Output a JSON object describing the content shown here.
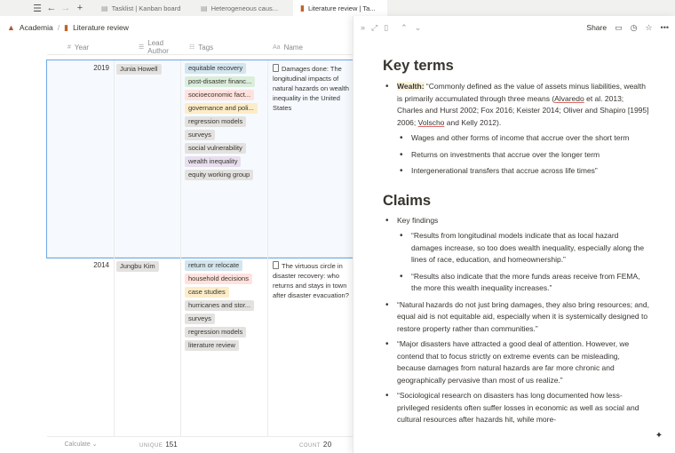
{
  "tabs": [
    {
      "label": "Tasklist | Kanban board",
      "active": false
    },
    {
      "label": "Heterogeneous caus...",
      "active": false
    },
    {
      "label": "Literature review | Ta...",
      "active": true
    }
  ],
  "breadcrumb": {
    "workspace": "Academia",
    "page": "Literature review"
  },
  "table": {
    "columns": {
      "year": "Year",
      "lead_author": "Lead Author",
      "tags": "Tags",
      "name": "Name"
    },
    "rows": [
      {
        "year": "2019",
        "lead_author": "Junia Howell",
        "tags": [
          "equitable recovery",
          "post-disaster financ...",
          "socioeconomic fact...",
          "governance and poli...",
          "regression models",
          "surveys",
          "social vulnerability",
          "wealth inequality",
          "equity working group"
        ],
        "name": "Damages done: The longitudinal impacts of natural hazards on wealth inequality in the United States"
      },
      {
        "year": "2014",
        "lead_author": "Jungbu Kim",
        "tags": [
          "return or relocate",
          "household decisions",
          "case studies",
          "hurricanes and stor...",
          "surveys",
          "regression models",
          "literature review"
        ],
        "name": "The virtuous circle in disaster recovery: who returns and stays in town after disaster evacuation?"
      }
    ],
    "footer": {
      "calculate": "Calculate",
      "unique_label": "UNIQUE",
      "unique_value": "151",
      "count_label": "COUNT",
      "count_value": "20"
    }
  },
  "peek": {
    "share_label": "Share",
    "key_terms_heading": "Key terms",
    "wealth_term": "Wealth:",
    "wealth_definition_a": "“Commonly defined as the value of assets minus liabilities, wealth is primarily accumulated through three means (",
    "wealth_cite_1": "Alvaredo",
    "wealth_definition_b": " et al. 2013; Charles and Hurst 2002; Fox 2016; Keister 2014; Oliver and Shapiro [1995] 2006; ",
    "wealth_cite_2": "Volscho",
    "wealth_definition_c": " and Kelly 2012).",
    "wealth_subitems": [
      "Wages and other forms of income that accrue over the short term",
      "Returns on investments that accrue over the longer term",
      "Intergenerational transfers that accrue across life times”"
    ],
    "claims_heading": "Claims",
    "key_findings_label": "Key findings",
    "key_findings": [
      "“Results from longitudinal models indicate that as local hazard damages increase, so too does wealth inequality, especially along the lines of race, education, and homeownership.”",
      "“Results also indicate that the more funds areas receive from FEMA, the more this wealth inequality increases.”"
    ],
    "claims": [
      "“Natural hazards do not just bring damages, they also bring resources; and, equal aid is not equitable aid, especially when it is systemically designed to restore property rather than communities.”",
      "“Major disasters have attracted a good deal of attention. However, we contend that to focus strictly on extreme events can be misleading, because damages from natural hazards are far more chronic and geographically pervasive than most of us realize.”",
      "“Sociological research on disasters has long documented how less-privileged residents often suffer losses in economic as well as social and cultural resources after hazards hit, while more-"
    ]
  },
  "colors": {
    "accent": "#2383e2",
    "tag_blue": "#d3e5ef",
    "tag_green": "#dbeddb",
    "tag_red": "#ffe2dd",
    "tag_yellow": "#fdecc8",
    "tag_gray": "#e3e2e0",
    "tag_purple": "#e8deee",
    "tag_orange": "#fadec9",
    "tag_pink": "#f5e0e9",
    "highlight": "#fbf3db"
  },
  "icons": [
    "menu-icon",
    "back-arrow-icon",
    "forward-arrow-icon",
    "plus-icon",
    "collapse-icon",
    "expand-icon",
    "layout-icon",
    "chevron-up-icon",
    "chevron-down-icon",
    "comment-icon",
    "history-icon",
    "star-icon",
    "more-icon",
    "sparkle-icon"
  ]
}
